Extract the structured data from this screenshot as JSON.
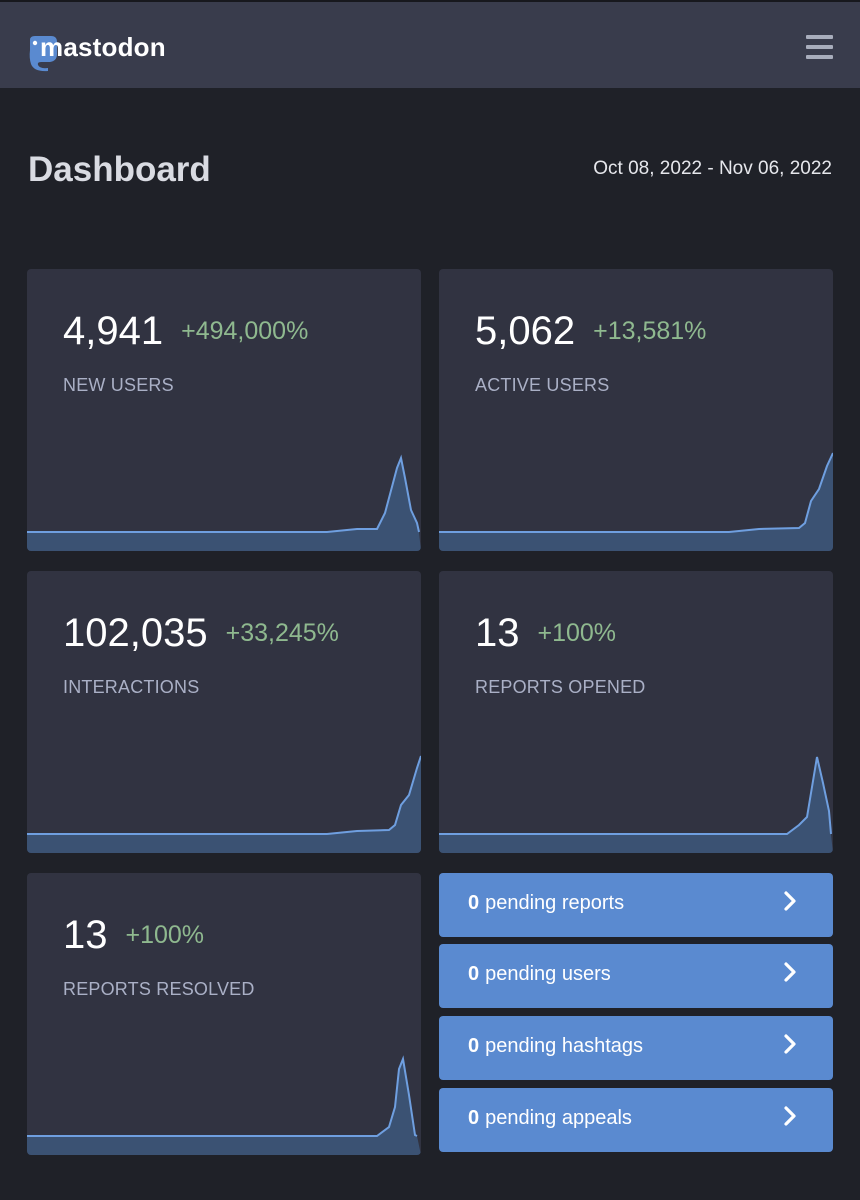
{
  "header": {
    "brand": "mastodon",
    "menu_icon": "hamburger-menu-icon"
  },
  "dashboard": {
    "title": "Dashboard",
    "date_range": "Oct 08, 2022 - Nov 06, 2022"
  },
  "metrics": [
    {
      "value": "4,941",
      "change": "+494,000%",
      "label": "NEW USERS"
    },
    {
      "value": "5,062",
      "change": "+13,581%",
      "label": "ACTIVE USERS"
    },
    {
      "value": "102,035",
      "change": "+33,245%",
      "label": "INTERACTIONS"
    },
    {
      "value": "13",
      "change": "+100%",
      "label": "REPORTS OPENED"
    },
    {
      "value": "13",
      "change": "+100%",
      "label": "REPORTS RESOLVED"
    }
  ],
  "pending": [
    {
      "count": "0",
      "label": "pending reports"
    },
    {
      "count": "0",
      "label": "pending users"
    },
    {
      "count": "0",
      "label": "pending hashtags"
    },
    {
      "count": "0",
      "label": "pending appeals"
    }
  ],
  "colors": {
    "background": "#1f2128",
    "topbar": "#393c4c",
    "card": "#313341",
    "positive_change": "#8fb98f",
    "accent_button": "#5a8ad0",
    "sparkline": "#6f9fe0"
  }
}
